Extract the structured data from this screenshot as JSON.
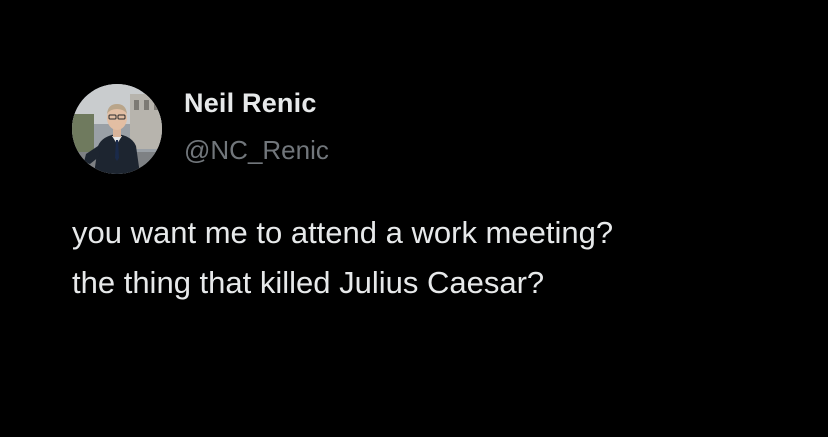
{
  "author": {
    "name": "Neil Renic",
    "handle": "@NC_Renic",
    "avatar_icon": "profile-photo-man-in-suit"
  },
  "tweet": {
    "lines": [
      "you want me to attend a work meeting?",
      "the thing that killed Julius Caesar?"
    ]
  },
  "colors": {
    "background": "#000000",
    "name_text": "#e7e9ea",
    "handle_text": "#71767b",
    "body_text": "#e7e9ea"
  }
}
